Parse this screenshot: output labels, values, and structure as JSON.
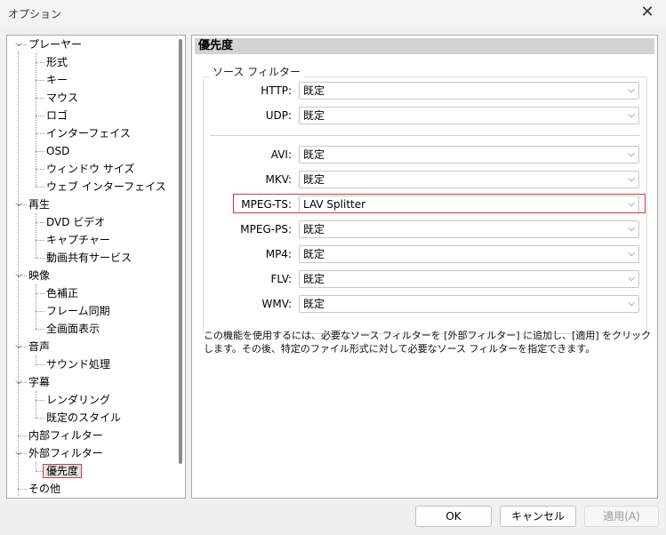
{
  "window": {
    "title": "オプション"
  },
  "tree": {
    "items": [
      {
        "label": "プレーヤー",
        "level": 0,
        "expanded": true
      },
      {
        "label": "形式",
        "level": 1
      },
      {
        "label": "キー",
        "level": 1
      },
      {
        "label": "マウス",
        "level": 1
      },
      {
        "label": "ロゴ",
        "level": 1
      },
      {
        "label": "インターフェイス",
        "level": 1
      },
      {
        "label": "OSD",
        "level": 1
      },
      {
        "label": "ウィンドウ サイズ",
        "level": 1
      },
      {
        "label": "ウェブ インターフェイス",
        "level": 1
      },
      {
        "label": "再生",
        "level": 0,
        "expanded": true
      },
      {
        "label": "DVD ビデオ",
        "level": 1
      },
      {
        "label": "キャプチャー",
        "level": 1
      },
      {
        "label": "動画共有サービス",
        "level": 1
      },
      {
        "label": "映像",
        "level": 0,
        "expanded": true
      },
      {
        "label": "色補正",
        "level": 1
      },
      {
        "label": "フレーム同期",
        "level": 1
      },
      {
        "label": "全画面表示",
        "level": 1
      },
      {
        "label": "音声",
        "level": 0,
        "expanded": true
      },
      {
        "label": "サウンド処理",
        "level": 1
      },
      {
        "label": "字幕",
        "level": 0,
        "expanded": true
      },
      {
        "label": "レンダリング",
        "level": 1
      },
      {
        "label": "既定のスタイル",
        "level": 1
      },
      {
        "label": "内部フィルター",
        "level": 0
      },
      {
        "label": "外部フィルター",
        "level": 0,
        "expanded": true
      },
      {
        "label": "優先度",
        "level": 1,
        "selected": true
      },
      {
        "label": "その他",
        "level": 0
      }
    ]
  },
  "panel": {
    "header": "優先度",
    "group_label": "ソース フィルター",
    "rows": [
      {
        "label": "HTTP:",
        "value": "既定"
      },
      {
        "label": "UDP:",
        "value": "既定"
      },
      {
        "label": "AVI:",
        "value": "既定"
      },
      {
        "label": "MKV:",
        "value": "既定"
      },
      {
        "label": "MPEG-TS:",
        "value": "LAV Splitter"
      },
      {
        "label": "MPEG-PS:",
        "value": "既定"
      },
      {
        "label": "MP4:",
        "value": "既定"
      },
      {
        "label": "FLV:",
        "value": "既定"
      },
      {
        "label": "WMV:",
        "value": "既定"
      }
    ],
    "description": "この機能を使用するには、必要なソース フィルターを [外部フィルター] に追加し、[適用] をクリックします。その後、特定のファイル形式に対して必要なソース フィルターを指定できます。"
  },
  "buttons": {
    "ok": "OK",
    "cancel": "キャンセル",
    "apply": "適用(A)"
  },
  "colors": {
    "highlight": "#d23b3b",
    "header_bg": "#d3d3d3"
  },
  "icons": {
    "close": "close-icon",
    "expand": "chevron-down-icon",
    "dropdown": "chevron-down-icon"
  }
}
